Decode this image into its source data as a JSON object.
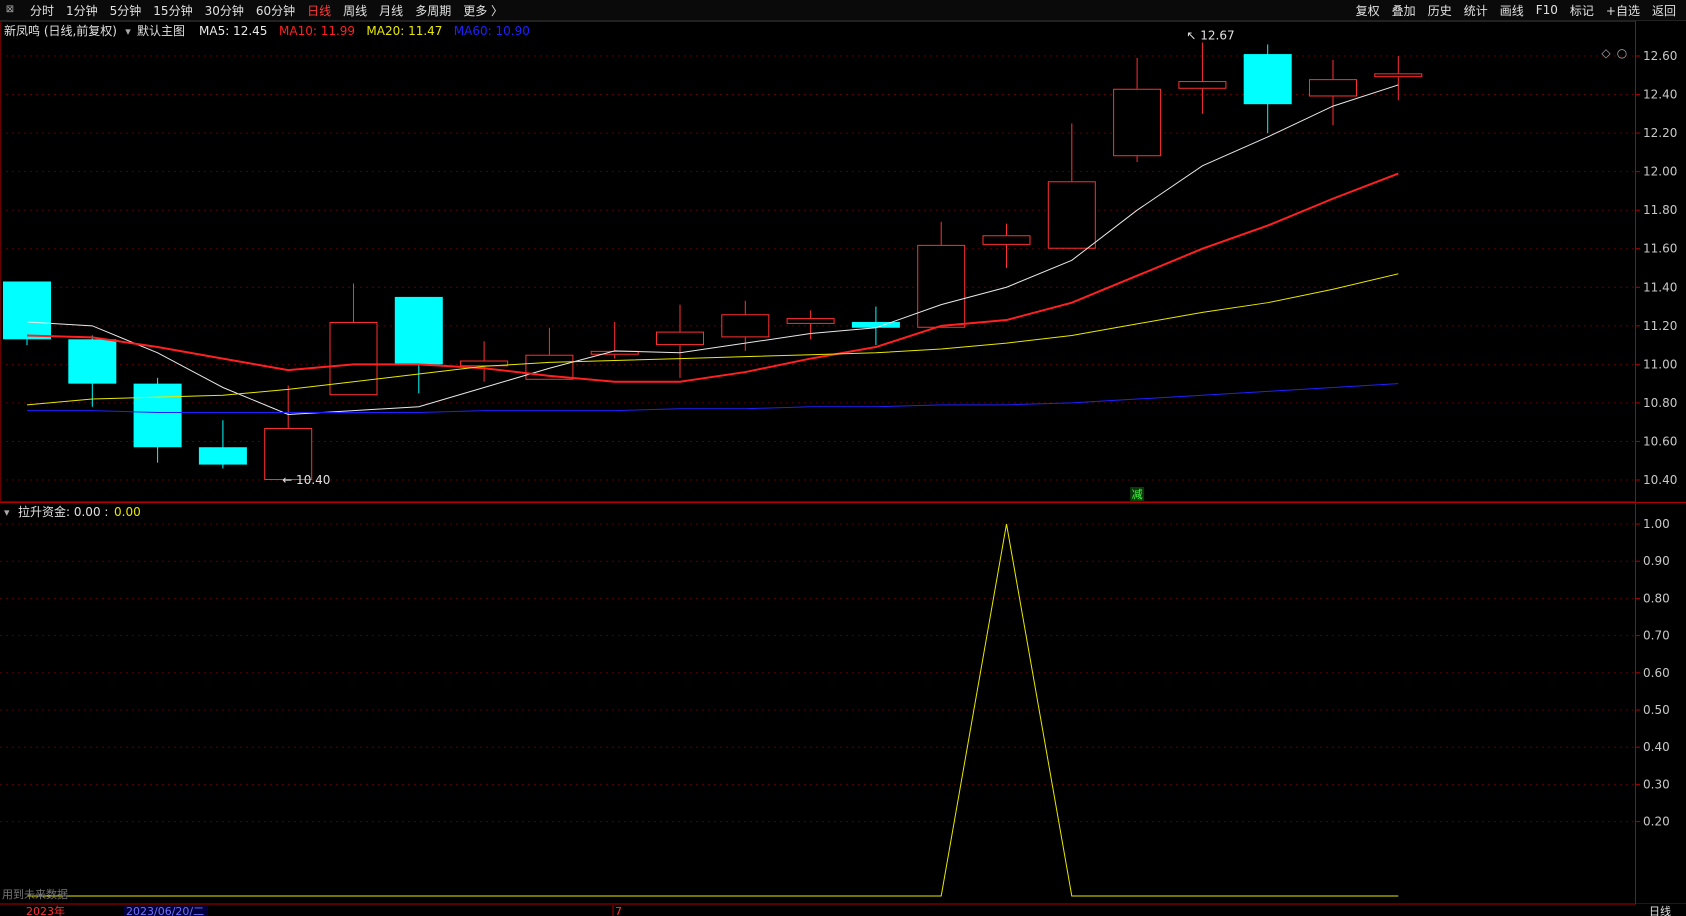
{
  "toolbar": {
    "menu_icon": "window-menu-icon",
    "periods": [
      {
        "label": "分时",
        "active": false
      },
      {
        "label": "1分钟",
        "active": false
      },
      {
        "label": "5分钟",
        "active": false
      },
      {
        "label": "15分钟",
        "active": false
      },
      {
        "label": "30分钟",
        "active": false
      },
      {
        "label": "60分钟",
        "active": false
      },
      {
        "label": "日线",
        "active": true
      },
      {
        "label": "周线",
        "active": false
      },
      {
        "label": "月线",
        "active": false
      },
      {
        "label": "多周期",
        "active": false
      },
      {
        "label": "更多 〉",
        "active": false
      }
    ],
    "tools": [
      "复权",
      "叠加",
      "历史",
      "统计",
      "画线",
      "F10",
      "标记",
      "+自选",
      "返回"
    ]
  },
  "main_panel": {
    "stock_title": "新凤鸣 (日线,前复权)",
    "indicator_name": "默认主图",
    "ma_legend": [
      {
        "label": "MA5: 12.45",
        "color": "#e8e8e8"
      },
      {
        "label": "MA10: 11.99",
        "color": "#ff2020"
      },
      {
        "label": "MA20: 11.47",
        "color": "#e8e800"
      },
      {
        "label": "MA60: 10.90",
        "color": "#2020ff"
      }
    ],
    "high_marker": "12.67",
    "low_marker": "10.40",
    "signal_badge": "减",
    "corner_icons": [
      "diamond-icon",
      "circle-icon"
    ]
  },
  "sub_panel": {
    "indicator_title": "拉升资金",
    "value_label": ": 0.00 : ",
    "value": "0.00",
    "footer_note": "用到未来数据"
  },
  "bottom_bar": {
    "year_label": "2023年",
    "date_label": "2023/06/20/二",
    "cursor_label": "7",
    "period_label": "日线"
  },
  "colors": {
    "up": "#ff3030",
    "down": "#00ffff",
    "grid": "#5a0000",
    "axis_text": "#c8c8c8"
  },
  "chart_data": [
    {
      "type": "candlestick",
      "title": "新凤鸣 (日线,前复权)",
      "ylim": [
        10.36,
        12.7
      ],
      "yticks": [
        10.4,
        10.6,
        10.8,
        11.0,
        11.2,
        11.4,
        11.6,
        11.8,
        12.0,
        12.2,
        12.4,
        12.6
      ],
      "ytick_labels": [
        "10.40",
        "10.60",
        "10.80",
        "11.00",
        "11.20",
        "11.40",
        "11.60",
        "11.80",
        "12.00",
        "12.20",
        "12.40",
        "12.60"
      ],
      "candles": [
        {
          "open": 11.43,
          "close": 11.13,
          "high": 11.43,
          "low": 11.1
        },
        {
          "open": 11.13,
          "close": 10.9,
          "high": 11.15,
          "low": 10.78
        },
        {
          "open": 10.9,
          "close": 10.57,
          "high": 10.93,
          "low": 10.49
        },
        {
          "open": 10.57,
          "close": 10.48,
          "high": 10.71,
          "low": 10.46
        },
        {
          "open": 10.4,
          "close": 10.67,
          "high": 10.89,
          "low": 10.4
        },
        {
          "open": 10.84,
          "close": 11.22,
          "high": 11.42,
          "low": 10.84
        },
        {
          "open": 11.35,
          "close": 11.0,
          "high": 11.35,
          "low": 10.85
        },
        {
          "open": 10.99,
          "close": 11.02,
          "high": 11.12,
          "low": 10.91
        },
        {
          "open": 10.92,
          "close": 11.05,
          "high": 11.19,
          "low": 10.92
        },
        {
          "open": 11.05,
          "close": 11.07,
          "high": 11.22,
          "low": 11.03
        },
        {
          "open": 11.1,
          "close": 11.17,
          "high": 11.31,
          "low": 10.93
        },
        {
          "open": 11.14,
          "close": 11.26,
          "high": 11.33,
          "low": 11.07
        },
        {
          "open": 11.21,
          "close": 11.24,
          "high": 11.28,
          "low": 11.13
        },
        {
          "open": 11.22,
          "close": 11.19,
          "high": 11.3,
          "low": 11.1
        },
        {
          "open": 11.19,
          "close": 11.62,
          "high": 11.74,
          "low": 11.19
        },
        {
          "open": 11.62,
          "close": 11.67,
          "high": 11.73,
          "low": 11.5
        },
        {
          "open": 11.6,
          "close": 11.95,
          "high": 12.25,
          "low": 11.6
        },
        {
          "open": 12.08,
          "close": 12.43,
          "high": 12.59,
          "low": 12.05
        },
        {
          "open": 12.43,
          "close": 12.47,
          "high": 12.67,
          "low": 12.3
        },
        {
          "open": 12.61,
          "close": 12.35,
          "high": 12.66,
          "low": 12.2
        },
        {
          "open": 12.39,
          "close": 12.48,
          "high": 12.58,
          "low": 12.24
        },
        {
          "open": 12.49,
          "close": 12.51,
          "high": 12.6,
          "low": 12.37
        }
      ],
      "ma_series": [
        {
          "name": "MA5",
          "color": "#e8e8e8",
          "width": 1,
          "values": [
            11.22,
            11.2,
            11.06,
            10.88,
            10.74,
            10.76,
            10.78,
            10.88,
            10.98,
            11.07,
            11.06,
            11.11,
            11.16,
            11.19,
            11.31,
            11.4,
            11.54,
            11.8,
            12.03,
            12.18,
            12.34,
            12.45
          ]
        },
        {
          "name": "MA10",
          "color": "#ff2020",
          "width": 2,
          "values": [
            11.15,
            11.14,
            11.09,
            11.03,
            10.97,
            11.0,
            11.0,
            10.98,
            10.94,
            10.91,
            10.91,
            10.96,
            11.03,
            11.09,
            11.2,
            11.23,
            11.32,
            11.46,
            11.6,
            11.72,
            11.86,
            11.99
          ]
        },
        {
          "name": "MA20",
          "color": "#e8e800",
          "width": 1,
          "values": [
            10.79,
            10.82,
            10.83,
            10.84,
            10.87,
            10.91,
            10.95,
            10.99,
            11.01,
            11.02,
            11.03,
            11.04,
            11.05,
            11.06,
            11.08,
            11.11,
            11.15,
            11.21,
            11.27,
            11.32,
            11.39,
            11.47
          ]
        },
        {
          "name": "MA60",
          "color": "#2020ff",
          "width": 1,
          "values": [
            10.76,
            10.76,
            10.75,
            10.75,
            10.75,
            10.75,
            10.75,
            10.76,
            10.76,
            10.76,
            10.77,
            10.77,
            10.78,
            10.78,
            10.79,
            10.79,
            10.8,
            10.82,
            10.84,
            10.86,
            10.88,
            10.9
          ]
        }
      ]
    },
    {
      "type": "line",
      "title": "拉升资金",
      "ylim": [
        0,
        1.04
      ],
      "yticks": [
        0.2,
        0.3,
        0.4,
        0.5,
        0.6,
        0.7,
        0.8,
        0.9,
        1.0
      ],
      "ytick_labels": [
        "0.20",
        "0.30",
        "0.40",
        "0.50",
        "0.60",
        "0.70",
        "0.80",
        "0.90",
        "1.00"
      ],
      "series": [
        {
          "color": "#e8e800",
          "values": [
            0,
            0,
            0,
            0,
            0,
            0,
            0,
            0,
            0,
            0,
            0,
            0,
            0,
            0,
            0,
            1,
            0,
            0,
            0,
            0,
            0,
            0
          ]
        }
      ]
    }
  ]
}
